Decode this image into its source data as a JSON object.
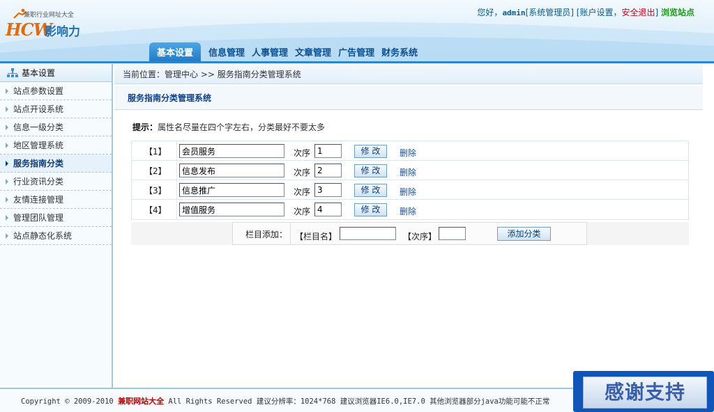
{
  "logo": {
    "tagline": "兼职行业网址大全",
    "mark": "HCW",
    "name": "影响力"
  },
  "user_bar": {
    "greeting": "您好，",
    "username": "admin",
    "role": "[系统管理员]",
    "account_settings": "[账户设置，",
    "logout": "安全退出",
    "close_bracket": "]",
    "browse_site": "浏览站点"
  },
  "nav": {
    "active_tab": "基本设置",
    "tabs": [
      "信息管理",
      "人事管理",
      "文章管理",
      "广告管理",
      "财务系统"
    ]
  },
  "sidebar": {
    "title": "基本设置",
    "items": [
      {
        "label": "站点参数设置"
      },
      {
        "label": "站点开设系统"
      },
      {
        "label": "信息一级分类"
      },
      {
        "label": "地区管理系统"
      },
      {
        "label": "服务指南分类",
        "active": true
      },
      {
        "label": "行业资讯分类"
      },
      {
        "label": "友情连接管理"
      },
      {
        "label": "管理团队管理"
      },
      {
        "label": "站点静态化系统"
      }
    ]
  },
  "breadcrumb": "当前位置：管理中心 >> 服务指南分类管理系统",
  "section_title": "服务指南分类管理系统",
  "tip": {
    "label": "提示：",
    "text": "属性名尽量在四个字左右，分类最好不要太多"
  },
  "categories": {
    "order_label": "次序",
    "edit_label": "修 改",
    "delete_label": "删除",
    "rows": [
      {
        "index": "【1】",
        "name": "会员服务",
        "order": "1"
      },
      {
        "index": "【2】",
        "name": "信息发布",
        "order": "2"
      },
      {
        "index": "【3】",
        "name": "信息推广",
        "order": "3"
      },
      {
        "index": "【4】",
        "name": "增值服务",
        "order": "4"
      }
    ]
  },
  "add_form": {
    "label": "栏目添加：",
    "name_label": "【栏目名】",
    "name_value": "",
    "order_label": "【次序】",
    "order_value": "",
    "button": "添加分类"
  },
  "footer": {
    "copyright": "Copyright © 2009-2010 ",
    "brand": "兼职网站大全",
    "rest": " All Rights Reserved  建议分辨率：1024*768 建议浏览器IE6.0,IE7.0 其他浏览器部分java功能可能不正常"
  },
  "thanks_badge": "感谢支持",
  "colors": {
    "accent": "#2a86d0",
    "nav_text": "#0b4f8f",
    "logout": "#d0021b",
    "browse": "#1a9b18",
    "brand_red": "#bb0000"
  }
}
